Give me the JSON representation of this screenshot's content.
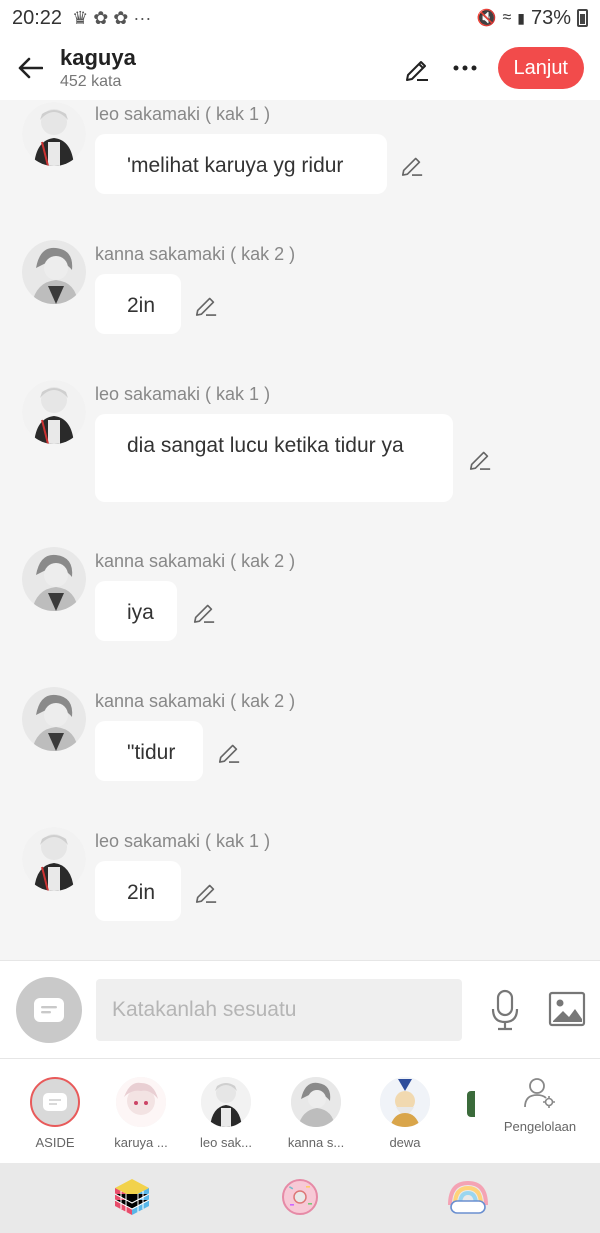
{
  "status_bar": {
    "time": "20:22",
    "battery": "73%"
  },
  "header": {
    "title": "kaguya",
    "subtitle": "452 kata",
    "next_label": "Lanjut"
  },
  "messages": [
    {
      "sender": "leo sakamaki ( kak 1 )",
      "text": "'melihat karuya yg ridur"
    },
    {
      "sender": "kanna sakamaki  ( kak 2 )",
      "text": "2in"
    },
    {
      "sender": "leo sakamaki ( kak 1 )",
      "text": "dia sangat lucu ketika tidur ya"
    },
    {
      "sender": "kanna sakamaki  ( kak 2 )",
      "text": "iya"
    },
    {
      "sender": "kanna sakamaki  ( kak 2 )",
      "text": "\"tidur"
    },
    {
      "sender": "leo sakamaki ( kak 1 )",
      "text": "2in"
    }
  ],
  "composer": {
    "placeholder": "Katakanlah sesuatu"
  },
  "characters": [
    {
      "name": "ASIDE"
    },
    {
      "name": "karuya ..."
    },
    {
      "name": "leo sak..."
    },
    {
      "name": "kanna s..."
    },
    {
      "name": "dewa"
    }
  ],
  "manage_label": "Pengelolaan",
  "colors": {
    "accent": "#f24b4b",
    "background": "#f5f5f5"
  }
}
